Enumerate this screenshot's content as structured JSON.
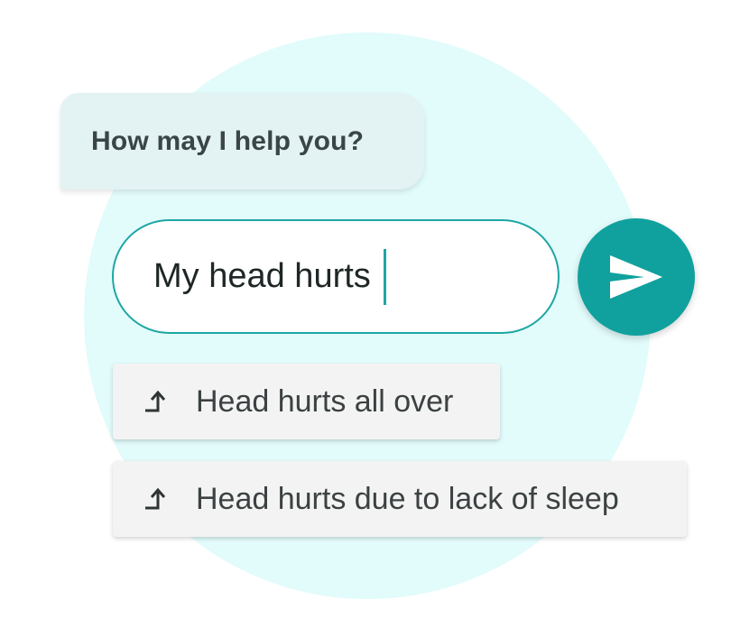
{
  "bot_message": {
    "text": "How may I help you?"
  },
  "input": {
    "value": "My head hurts"
  },
  "send_button": {
    "icon": "send-icon"
  },
  "suggestions": [
    {
      "icon": "arrow-turn-up-icon",
      "label": "Head hurts all over"
    },
    {
      "icon": "arrow-turn-up-icon",
      "label": "Head hurts due to lack of sleep"
    }
  ],
  "colors": {
    "accent": "#10a19e",
    "background_circle": "#e2fbfb",
    "bot_bubble": "#e3f2f2",
    "suggestion_bg": "#f3f3f3"
  }
}
